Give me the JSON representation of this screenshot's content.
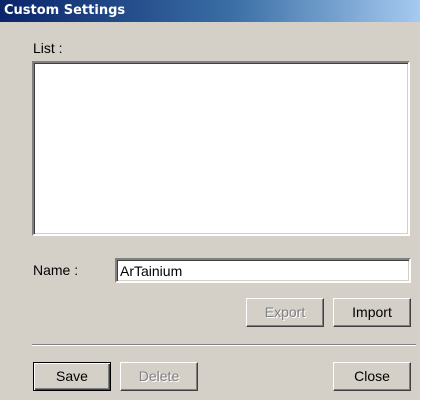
{
  "window": {
    "title": "Custom Settings"
  },
  "list": {
    "label": "List :",
    "items": []
  },
  "name_field": {
    "label": "Name :",
    "value": "ArTainium"
  },
  "buttons": {
    "export": "Export",
    "import": "Import",
    "save": "Save",
    "delete": "Delete",
    "close": "Close"
  }
}
